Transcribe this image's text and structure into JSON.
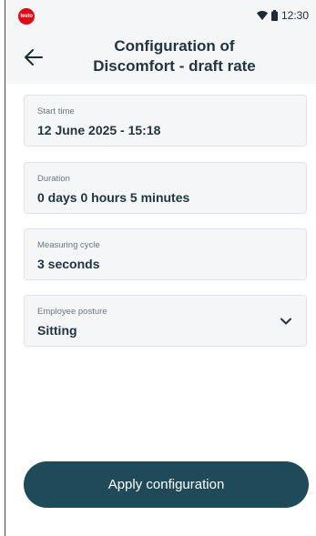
{
  "status_bar": {
    "brand_logo": "testo",
    "time": "12:30",
    "icons": [
      "wifi-icon",
      "battery-icon"
    ]
  },
  "header": {
    "back_icon": "arrow-left-icon",
    "title_line1": "Configuration of",
    "title_line2": "Discomfort - draft rate"
  },
  "fields": {
    "start_time": {
      "label": "Start time",
      "value": "12 June 2025 - 15:18"
    },
    "duration": {
      "label": "Duration",
      "value": "0 days 0 hours 5 minutes"
    },
    "measuring_cycle": {
      "label": "Measuring cycle",
      "value": "3 seconds"
    },
    "employee_posture": {
      "label": "Employee posture",
      "value": "Sitting",
      "icon": "chevron-down-icon"
    }
  },
  "actions": {
    "apply_label": "Apply configuration"
  },
  "colors": {
    "primary": "#1f4a59",
    "surface": "#f5f6f8",
    "text": "#223541",
    "brand_red": "#e30613"
  }
}
